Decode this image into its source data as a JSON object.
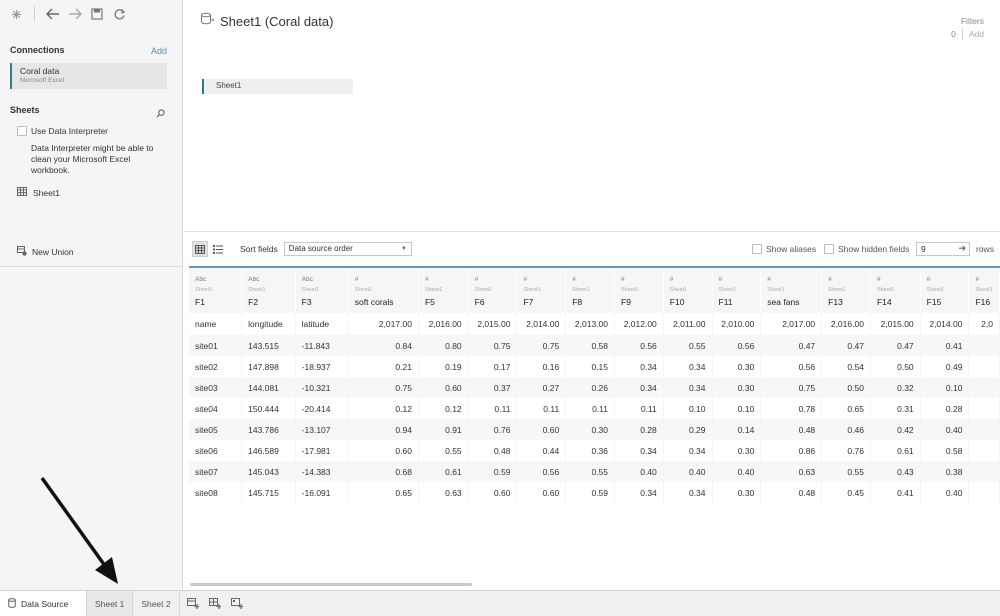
{
  "left_pane": {
    "connections_heading": "Connections",
    "connections_add": "Add",
    "connection": {
      "name": "Coral data",
      "type": "Microsoft Excel"
    },
    "sheets_heading": "Sheets",
    "data_interpreter_label": "Use Data Interpreter",
    "data_interpreter_desc": "Data Interpreter might be able to clean your Microsoft Excel workbook.",
    "sheet_item": "Sheet1",
    "new_union": "New Union"
  },
  "canvas": {
    "title": "Sheet1 (Coral data)",
    "filters_label": "Filters",
    "filters_count": "0",
    "filters_add": "Add",
    "sheet_pill": "Sheet1"
  },
  "grid_toolbar": {
    "sort_label": "Sort fields",
    "sort_value": "Data source order",
    "show_aliases": "Show aliases",
    "show_hidden": "Show hidden fields",
    "rows_value": "9",
    "rows_label": "rows"
  },
  "columns": [
    {
      "type": "Abc",
      "src": "Sheet1",
      "name": "F1"
    },
    {
      "type": "Abc",
      "src": "Sheet1",
      "name": "F2"
    },
    {
      "type": "Abc",
      "src": "Sheet1",
      "name": "F3"
    },
    {
      "type": "#",
      "src": "Sheet1",
      "name": "soft corals"
    },
    {
      "type": "#",
      "src": "Sheet1",
      "name": "F5"
    },
    {
      "type": "#",
      "src": "Sheet1",
      "name": "F6"
    },
    {
      "type": "#",
      "src": "Sheet1",
      "name": "F7"
    },
    {
      "type": "#",
      "src": "Sheet1",
      "name": "F8"
    },
    {
      "type": "#",
      "src": "Sheet1",
      "name": "F9"
    },
    {
      "type": "#",
      "src": "Sheet1",
      "name": "F10"
    },
    {
      "type": "#",
      "src": "Sheet1",
      "name": "F11"
    },
    {
      "type": "#",
      "src": "Sheet1",
      "name": "sea fans"
    },
    {
      "type": "#",
      "src": "Sheet1",
      "name": "F13"
    },
    {
      "type": "#",
      "src": "Sheet1",
      "name": "F14"
    },
    {
      "type": "#",
      "src": "Sheet1",
      "name": "F15"
    },
    {
      "type": "#",
      "src": "Sheet1",
      "name": "F16"
    }
  ],
  "rows": [
    [
      "name",
      "longitude",
      "latitude",
      "2,017.00",
      "2,016.00",
      "2,015.00",
      "2,014.00",
      "2,013.00",
      "2,012.00",
      "2,011.00",
      "2,010.00",
      "2,017.00",
      "2,016.00",
      "2,015.00",
      "2,014.00",
      "2,0"
    ],
    [
      "site01",
      "143.515",
      "-11.843",
      "0.84",
      "0.80",
      "0.75",
      "0.75",
      "0.58",
      "0.56",
      "0.55",
      "0.56",
      "0.47",
      "0.47",
      "0.47",
      "0.41",
      ""
    ],
    [
      "site02",
      "147.898",
      "-18.937",
      "0.21",
      "0.19",
      "0.17",
      "0.16",
      "0.15",
      "0.34",
      "0.34",
      "0.30",
      "0.56",
      "0.54",
      "0.50",
      "0.49",
      ""
    ],
    [
      "site03",
      "144.081",
      "-10.321",
      "0.75",
      "0.60",
      "0.37",
      "0.27",
      "0.26",
      "0.34",
      "0.34",
      "0.30",
      "0.75",
      "0.50",
      "0.32",
      "0.10",
      ""
    ],
    [
      "site04",
      "150.444",
      "-20.414",
      "0.12",
      "0.12",
      "0.11",
      "0.11",
      "0.11",
      "0.11",
      "0.10",
      "0.10",
      "0.78",
      "0.65",
      "0.31",
      "0.28",
      ""
    ],
    [
      "site05",
      "143.786",
      "-13.107",
      "0.94",
      "0.91",
      "0.76",
      "0.60",
      "0.30",
      "0.28",
      "0.29",
      "0.14",
      "0.48",
      "0.46",
      "0.42",
      "0.40",
      ""
    ],
    [
      "site06",
      "146.589",
      "-17.981",
      "0.60",
      "0.55",
      "0.48",
      "0.44",
      "0.36",
      "0.34",
      "0.34",
      "0.30",
      "0.86",
      "0.76",
      "0.61",
      "0.58",
      ""
    ],
    [
      "site07",
      "145.043",
      "-14.383",
      "0.68",
      "0.61",
      "0.59",
      "0.56",
      "0.55",
      "0.40",
      "0.40",
      "0.40",
      "0.63",
      "0.55",
      "0.43",
      "0.38",
      ""
    ],
    [
      "site08",
      "145.715",
      "-16.091",
      "0.65",
      "0.63",
      "0.60",
      "0.60",
      "0.59",
      "0.34",
      "0.34",
      "0.30",
      "0.48",
      "0.45",
      "0.41",
      "0.40",
      ""
    ]
  ],
  "bottom_tabs": {
    "data_source": "Data Source",
    "sheet1": "Sheet 1",
    "sheet2": "Sheet 2"
  },
  "colors": {
    "accent": "#2a7f7f",
    "header_rule": "#5d9cb3"
  }
}
